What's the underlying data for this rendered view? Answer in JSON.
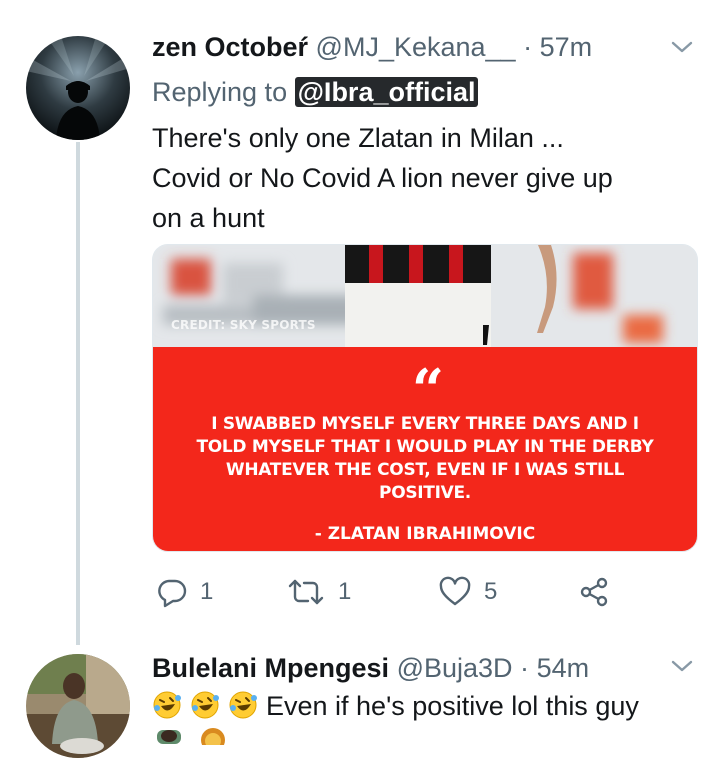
{
  "tweets": [
    {
      "name": "zen Octobeŕ",
      "handle": "@MJ_Kekana__",
      "separator": "·",
      "time": "57m",
      "replying_prefix": "Replying to",
      "replying_to": "@Ibra_official",
      "text_lines": [
        "There's only one Zlatan in Milan ...",
        "Covid or No  Covid  A lion never give up",
        "on a hunt"
      ],
      "media": {
        "credit": "CREDIT: SKY SPORTS",
        "quote_mark": "“",
        "quote_lines": [
          "I SWABBED MYSELF EVERY THREE DAYS AND I",
          "TOLD MYSELF THAT I WOULD PLAY IN THE DERBY",
          "WHATEVER THE COST, EVEN IF I WAS STILL",
          "POSITIVE."
        ],
        "author": "- ZLATAN IBRAHIMOVIC",
        "panel_color": "#f3271b"
      },
      "actions": {
        "reply_count": "1",
        "retweet_count": "1",
        "like_count": "5"
      }
    },
    {
      "name": "Bulelani Mpengesi",
      "handle": "@Buja3D",
      "separator": "·",
      "time": "54m",
      "text": "Even if he's positive lol this guy",
      "emojis": [
        "rofl-emoji",
        "rofl-emoji",
        "rofl-emoji"
      ]
    }
  ],
  "colors": {
    "secondary_text": "#536471",
    "thread_line": "#cfd9de",
    "mention_bg": "#26292c"
  }
}
